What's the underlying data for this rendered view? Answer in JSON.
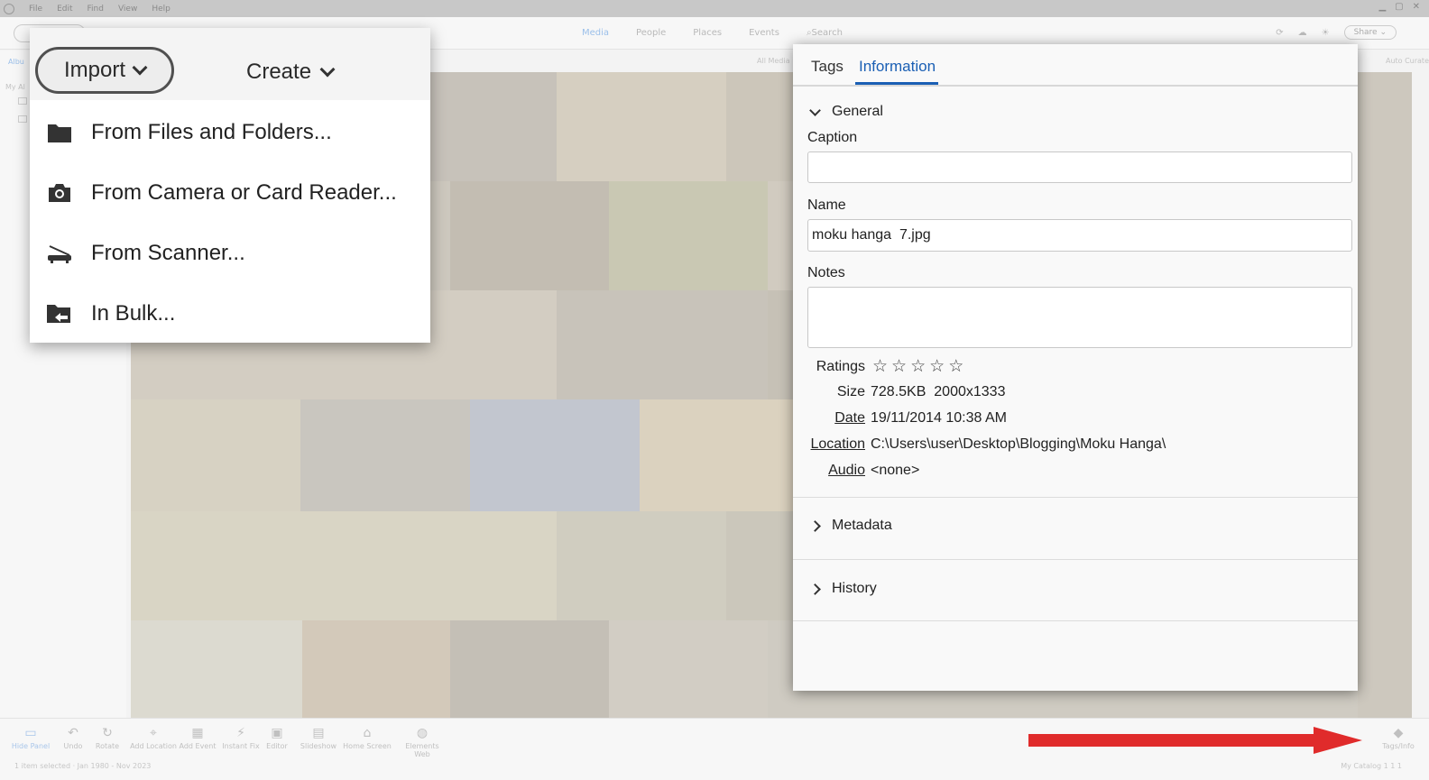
{
  "menubar": {
    "items": [
      "File",
      "Edit",
      "Find",
      "View",
      "Help"
    ]
  },
  "topbar": {
    "nav": [
      "Media",
      "People",
      "Places",
      "Events"
    ],
    "search_placeholder": "Search",
    "share_label": "Share"
  },
  "subbar": {
    "left": "Albu",
    "mid": "All Media",
    "right": "Auto Curate"
  },
  "leftpanel": {
    "my_albums": "My Al"
  },
  "import_menu": {
    "import_label": "Import",
    "create_label": "Create",
    "items": [
      {
        "label": "From Files and Folders...",
        "icon": "folder-icon"
      },
      {
        "label": "From Camera or Card Reader...",
        "icon": "camera-icon"
      },
      {
        "label": "From Scanner...",
        "icon": "scanner-icon"
      },
      {
        "label": "In Bulk...",
        "icon": "bulk-import-icon"
      }
    ]
  },
  "info_panel": {
    "tabs": [
      "Tags",
      "Information"
    ],
    "active_tab": "Information",
    "general": {
      "title": "General",
      "caption_label": "Caption",
      "caption_value": "",
      "name_label": "Name",
      "name_value": "moku hanga  7.jpg",
      "notes_label": "Notes",
      "notes_value": "",
      "ratings_label": "Ratings",
      "rating": 0,
      "size_label": "Size",
      "size_value": "728.5KB  2000x1333",
      "date_label": "Date",
      "date_value": "19/11/2014 10:38 AM",
      "location_label": "Location",
      "location_value": "C:\\Users\\user\\Desktop\\Blogging\\Moku Hanga\\",
      "audio_label": "Audio",
      "audio_value": "<none>"
    },
    "metadata_title": "Metadata",
    "history_title": "History"
  },
  "bottom_toolbar": {
    "tools": [
      "Hide Panel",
      "Undo",
      "Rotate",
      "Add Location",
      "Add Event",
      "Instant Fix",
      "Editor",
      "Slideshow",
      "Home Screen",
      "Elements Web"
    ],
    "tags_info": "Tags/Info"
  },
  "status": {
    "left": "1 item selected · Jan 1980 - Nov 2023",
    "right": "My Catalog 1 1 1"
  },
  "colors": {
    "accent": "#1a5fb4",
    "arrow": "#e02b2b"
  }
}
